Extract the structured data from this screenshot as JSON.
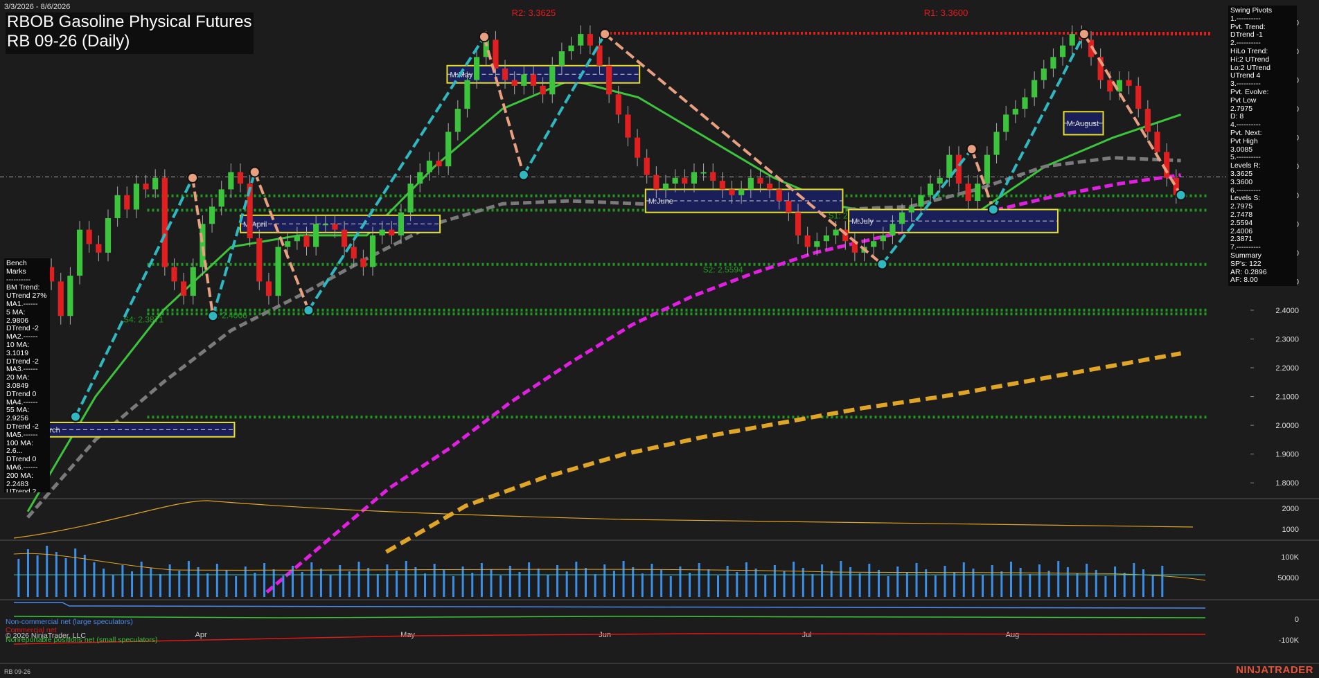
{
  "header": {
    "title": "RBOB Gasoline Physical Futures",
    "subtitle": "RB 09-26 (Daily)",
    "date_range": "3/3/2026 - 8/6/2026"
  },
  "swing_pivots_text": "Swing Pivots\n1.----------\nPvt. Trend:\nDTrend -1\n2.----------\nHiLo Trend:\nHi:2 UTrend\nLo:2 UTrend\nUTrend 4\n3.----------\nPvt. Evolve:\nPvt Low\n2.7975\nD: 8\n4.----------\nPvt. Next:\nPvt High\n3.0085\n5.----------\nLevels R:\n3.3625\n3.3600\n6.----------\nLevels S:\n2.7975\n2.7478\n2.5594\n2.4006\n2.3871\n7.----------\nSummary\nSP's: 122\nAR: 0.2896\nAF: 8.00",
  "bench_marks_text": "Bench Marks\n----------\nBM Trend:\nUTrend 27%\nMA1.------\n5 MA:\n2.9806\nDTrend -2\nMA2.------\n10 MA:\n3.1019\nDTrend -2\nMA3.------\n20 MA:\n3.0849\nDTrend 0\nMA4.------\n55 MA:\n2.9256\nDTrend -2\nMA5.------\n100 MA:\n2.6...\nDTrend 0\nMA6.------\n200 MA:\n2.2483\nUTrend 2",
  "legend": {
    "noncommercial": "Non-commercial net (large speculators)",
    "commercial": "Commercial net",
    "nonreportable": "Nonreportable positions net (small speculators)",
    "copyright": "© 2026 NinjaTrader, LLC"
  },
  "footer": {
    "instrument": "RB 09-26",
    "brand": "NINJATRADER"
  },
  "colors": {
    "background": "#1c1c1c",
    "up_candle": "#3cc43c",
    "down_candle": "#e02020",
    "resistance": "#e81b1b",
    "support": "#1f9a1f",
    "ma200": "#e0a526",
    "ma100": "#e020e0",
    "ma55": "#7a7a7a",
    "ma20": "#3cc43c",
    "swing_up": "#2fb8c0",
    "swing_down": "#e8a080"
  },
  "chart_data": {
    "type": "candlestick",
    "x_ticks": [
      "Apr",
      "May",
      "Jun",
      "Jul",
      "Aug"
    ],
    "y_ticks": [
      "3.4000",
      "3.3000",
      "3.2000",
      "3.1000",
      "3.0000",
      "2.9000",
      "2.8000",
      "2.7000",
      "2.6000",
      "2.5000",
      "2.4000",
      "2.3000",
      "2.2000",
      "2.1000",
      "2.0000",
      "1.9000",
      "1.8000"
    ],
    "ylim": [
      1.75,
      3.43
    ],
    "bars": [
      2.4,
      2.55,
      2.5,
      2.38,
      2.52,
      2.68,
      2.63,
      2.6,
      2.72,
      2.8,
      2.75,
      2.84,
      2.82,
      2.86,
      2.55,
      2.5,
      2.45,
      2.55,
      2.7,
      2.76,
      2.82,
      2.88,
      2.84,
      2.65,
      2.5,
      2.45,
      2.62,
      2.64,
      2.66,
      2.62,
      2.7,
      2.7,
      2.68,
      2.62,
      2.58,
      2.55,
      2.66,
      2.68,
      2.66,
      2.74,
      2.84,
      2.88,
      2.92,
      2.9,
      3.02,
      3.1,
      3.2,
      3.28,
      3.34,
      3.24,
      3.2,
      3.18,
      3.22,
      3.18,
      3.15,
      3.25,
      3.3,
      3.32,
      3.36,
      3.32,
      3.25,
      3.15,
      3.08,
      3.0,
      2.93,
      2.87,
      2.82,
      2.84,
      2.86,
      2.84,
      2.88,
      2.88,
      2.85,
      2.82,
      2.8,
      2.82,
      2.86,
      2.84,
      2.82,
      2.78,
      2.74,
      2.66,
      2.62,
      2.64,
      2.66,
      2.68,
      2.64,
      2.6,
      2.62,
      2.64,
      2.66,
      2.7,
      2.74,
      2.76,
      2.8,
      2.84,
      2.86,
      2.94,
      2.84,
      2.78,
      2.84,
      2.94,
      3.02,
      3.08,
      3.1,
      3.14,
      3.2,
      3.24,
      3.28,
      3.32,
      3.36,
      3.34,
      3.28,
      3.2,
      3.16,
      3.2,
      3.18,
      3.1,
      3.02,
      2.95,
      2.86,
      2.8
    ],
    "resistance": [
      {
        "label": "R2: 3.3625",
        "value": 3.3625
      },
      {
        "label": "R1: 3.3600",
        "value": 3.36
      }
    ],
    "support": [
      {
        "label": "S4: 2.3871",
        "value": 2.3871
      },
      {
        "label": "S3: 2.4006",
        "value": 2.4006
      },
      {
        "label": "S2: 2.5594",
        "value": 2.5594
      },
      {
        "label": "S1: 2.7478",
        "value": 2.7478
      }
    ],
    "support_extra": [
      2.0286,
      2.7975
    ],
    "current_price": 2.8633,
    "moving_averages": [
      {
        "name": "20 MA",
        "values": [
          1.7,
          2.1,
          2.4,
          2.62,
          2.66,
          2.66,
          2.9,
          3.1,
          3.2,
          3.14,
          3.0,
          2.86,
          2.76,
          2.72,
          2.74,
          2.9,
          3.0,
          3.08
        ]
      },
      {
        "name": "55 MA",
        "values": [
          1.68,
          1.95,
          2.15,
          2.33,
          2.45,
          2.58,
          2.7,
          2.77,
          2.78,
          2.77,
          2.76,
          2.75,
          2.75,
          2.76,
          2.82,
          2.9,
          2.93,
          2.92
        ]
      },
      {
        "name": "100 MA",
        "values": [
          1.42,
          1.6,
          1.78,
          1.92,
          2.08,
          2.22,
          2.35,
          2.45,
          2.53,
          2.6,
          2.65,
          2.7,
          2.75,
          2.8,
          2.84,
          2.87
        ]
      },
      {
        "name": "200 MA",
        "values": [
          1.56,
          1.72,
          1.82,
          1.9,
          1.96,
          2.01,
          2.06,
          2.1,
          2.15,
          2.2,
          2.25
        ]
      }
    ],
    "monthly_boxes": [
      {
        "label": "M:March",
        "x0": 0,
        "x1": 0.173,
        "y0": 1.96,
        "y1": 2.01
      },
      {
        "label": "M:April",
        "x0": 0.178,
        "x1": 0.345,
        "y0": 2.67,
        "y1": 2.73
      },
      {
        "label": "M:May",
        "x0": 0.351,
        "x1": 0.512,
        "y0": 3.19,
        "y1": 3.25
      },
      {
        "label": "M:June",
        "x0": 0.517,
        "x1": 0.682,
        "y0": 2.74,
        "y1": 2.82
      },
      {
        "label": "M:July",
        "x0": 0.687,
        "x1": 0.862,
        "y0": 2.67,
        "y1": 2.75
      },
      {
        "label": "M:August",
        "x0": 0.867,
        "x1": 0.9,
        "y0": 3.01,
        "y1": 3.09
      }
    ],
    "swing_points": [
      {
        "x": 0.04,
        "y": 2.03,
        "t": "L"
      },
      {
        "x": 0.138,
        "y": 2.86,
        "t": "H"
      },
      {
        "x": 0.155,
        "y": 2.38,
        "t": "L"
      },
      {
        "x": 0.19,
        "y": 2.88,
        "t": "H"
      },
      {
        "x": 0.235,
        "y": 2.4,
        "t": "L"
      },
      {
        "x": 0.382,
        "y": 3.35,
        "t": "H"
      },
      {
        "x": 0.415,
        "y": 2.87,
        "t": "L"
      },
      {
        "x": 0.483,
        "y": 3.36,
        "t": "H"
      },
      {
        "x": 0.715,
        "y": 2.56,
        "t": "L"
      },
      {
        "x": 0.79,
        "y": 2.96,
        "t": "H"
      },
      {
        "x": 0.808,
        "y": 2.75,
        "t": "L"
      },
      {
        "x": 0.884,
        "y": 3.36,
        "t": "H"
      },
      {
        "x": 0.965,
        "y": 2.8,
        "t": "L"
      }
    ],
    "oscillator": {
      "ticks": [
        "2000",
        "1000"
      ]
    },
    "volume": {
      "ticks": [
        "100K",
        "50000"
      ]
    },
    "cot": {
      "ticks": [
        "0",
        "-100K"
      ]
    }
  }
}
